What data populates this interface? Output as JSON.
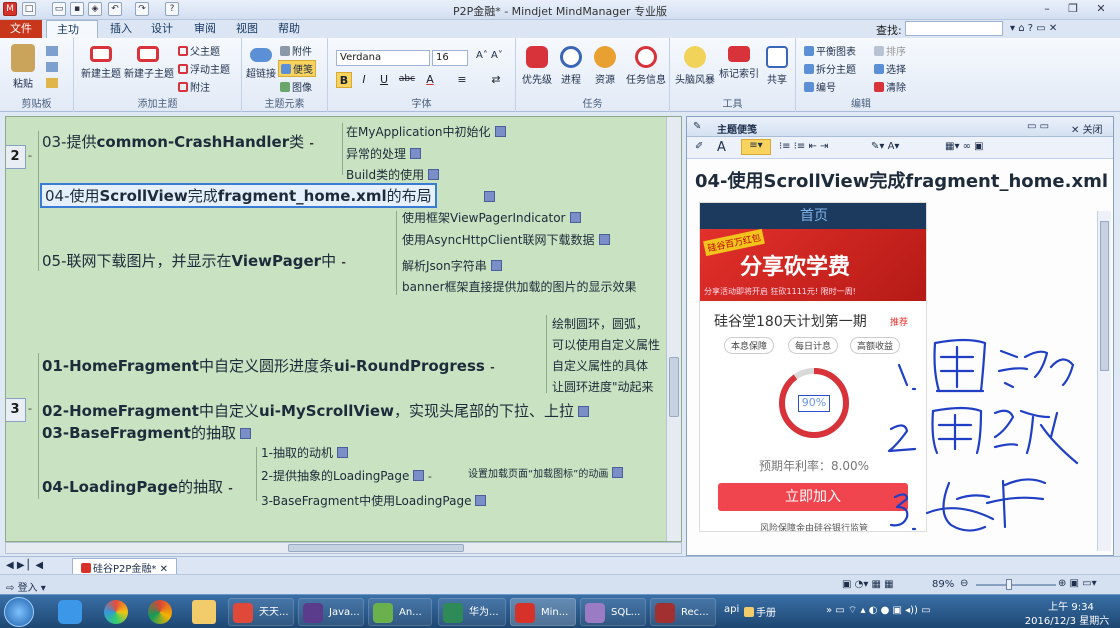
{
  "window": {
    "title": "P2P金融* - Mindjet MindManager 专业版"
  },
  "tabs": [
    "文件",
    "主功能",
    "插入",
    "设计",
    "审阅",
    "视图",
    "帮助"
  ],
  "find": {
    "label": "查找:",
    "placeholder": ""
  },
  "ribbon": {
    "clipboard": {
      "paste": "粘贴",
      "group": "剪贴板"
    },
    "add_topic": {
      "new_topic": "新建主题",
      "new_subtopic": "新建子主题",
      "parent": "父主题",
      "floating": "浮动主题",
      "callout": "附注",
      "group": "添加主题"
    },
    "topic_elements": {
      "hyperlink": "超链接",
      "attachment": "附件",
      "notes": "便笺",
      "image": "图像",
      "group": "主题元素"
    },
    "font": {
      "name": "Verdana",
      "size": "16",
      "bold": "B",
      "italic": "I",
      "underline": "U",
      "strike": "abc",
      "group": "字体"
    },
    "task": {
      "priority": "优先级",
      "progress": "进程",
      "resource": "资源",
      "task_info": "任务信息",
      "group": "任务"
    },
    "tools": {
      "brainstorm": "头脑风暴",
      "markers": "标记索引",
      "share": "共享",
      "group": "工具"
    },
    "edit": {
      "flat": "平衡图表",
      "split": "拆分主题",
      "number": "编号",
      "sort": "排序",
      "select": "选择",
      "clear": "清除",
      "group": "编辑"
    }
  },
  "map": {
    "branch2_label": "2",
    "branch3_label": "3",
    "t03_crash": {
      "prefix": "03-提供",
      "bold": "common-CrashHandler",
      "suffix": "类"
    },
    "crash_subs": [
      "在MyApplication中初始化",
      "异常的处理",
      "Build类的使用"
    ],
    "t04_scroll": {
      "prefix": "04-使用",
      "bold": "ScrollView",
      "mid": "完成",
      "bold2": "fragment_home.xml",
      "suffix": "的布局"
    },
    "t05_viewpager": {
      "prefix": "05-联网下载图片，并显示在",
      "bold": "ViewPager",
      "suffix": "中"
    },
    "vp_subs": [
      "使用框架ViewPagerIndicator",
      "使用AsyncHttpClient联网下载数据",
      "解析Json字符串",
      "banner框架直接提供加载的图片的显示效果"
    ],
    "t01_round": {
      "prefix": "01-HomeFragment",
      "mid": "中自定义圆形进度条",
      "bold": "ui-RoundProgress"
    },
    "round_subs": [
      "绘制圆环，圆弧，",
      "可以使用自定义属性",
      "自定义属性的具体",
      "让圆环进度\"动起来"
    ],
    "t02_myscroll": {
      "prefix": "02-HomeFragment",
      "mid": "中自定义",
      "bold": "ui-MyScrollView",
      "suffix": "，实现头尾部的下拉、上拉"
    },
    "t03_base": {
      "prefix": "03-BaseFragment",
      "suffix": "的抽取"
    },
    "t04_loading": {
      "prefix": "04-LoadingPage",
      "suffix": "的抽取"
    },
    "loading_subs": [
      "1-抽取的动机",
      "2-提供抽象的LoadingPage",
      "3-BaseFragment中使用LoadingPage"
    ],
    "loading_sub2_child": "设置加载页面“加载图标”的动画"
  },
  "notes_panel": {
    "title": "主题便笺",
    "close": "关闭",
    "heading": "04-使用ScrollView完成fragment_home.xml",
    "phone": {
      "header": "首页",
      "banner_tag": "硅谷百万红包",
      "banner_text": "分享砍学费",
      "banner_bottom": "分享活动即将开启 狂砍1111元! 限时一周!",
      "product": "硅谷堂180天计划第一期",
      "product_badge": "推荐",
      "chips": [
        "本息保障",
        "每日计息",
        "高额收益"
      ],
      "progress": "90%",
      "progress_value": 0.9,
      "rate": "预期年利率：8.00%",
      "join": "立即加入",
      "footer": "风险保障金由硅谷银行监管"
    }
  },
  "doc_tab": "硅谷P2P金融*",
  "status": {
    "login": "登入",
    "zoom": "89%"
  },
  "taskbar": {
    "items": [
      "天天...",
      "Java...",
      "An...",
      "华为...",
      "Min...",
      "SQL...",
      "Rec..."
    ],
    "api": "api",
    "manual": "手册",
    "time": "上午 9:34",
    "date": "2016/12/3 星期六"
  },
  "colors": {
    "canvas": "#c9e2c1",
    "accent_red": "#d8323a",
    "taskbar": "#1d4773",
    "file_tab": "#c8361c"
  }
}
